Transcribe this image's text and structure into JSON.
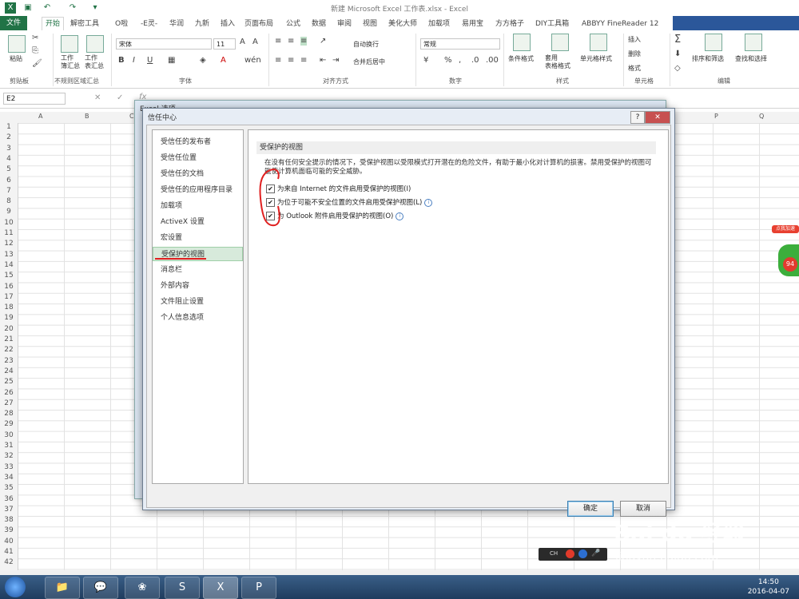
{
  "window": {
    "title": "新建 Microsoft Excel 工作表.xlsx - Excel"
  },
  "tabs": [
    "文件",
    "开始",
    "解密工具",
    "O啦",
    "-E灵-",
    "华润",
    "九新",
    "插入",
    "页面布局",
    "公式",
    "数据",
    "审阅",
    "视图",
    "美化大师",
    "加载项",
    "易用宝",
    "方方格子",
    "DIY工具箱",
    "ABBYY FineReader 12"
  ],
  "ribbon": {
    "paste": "粘贴",
    "summary1": "工作\n簿汇总",
    "summary2": "工作\n表汇总",
    "font_name": "宋体",
    "font_size": "11",
    "wrap": "自动换行",
    "merge": "合并后居中",
    "number_format": "常规",
    "cond_format": "条件格式",
    "table_format": "套用\n表格格式",
    "cell_style": "单元格样式",
    "insert": "插入",
    "delete": "删除",
    "format": "格式",
    "sort": "排序和筛选",
    "find": "查找和选择",
    "groups": [
      "剪贴板",
      "不规则区域汇总",
      "字体",
      "对齐方式",
      "数字",
      "样式",
      "单元格",
      "编辑"
    ]
  },
  "formula_bar": {
    "name_box": "E2"
  },
  "columns": [
    "A",
    "B",
    "C",
    "P",
    "Q"
  ],
  "rows": [
    "1",
    "2",
    "3",
    "4",
    "5",
    "6",
    "7",
    "8",
    "9",
    "10",
    "11",
    "12",
    "13",
    "14",
    "15",
    "16",
    "17",
    "18",
    "19",
    "20",
    "21",
    "22",
    "23",
    "24",
    "25",
    "26",
    "27",
    "28",
    "29",
    "30",
    "31",
    "32",
    "33",
    "34",
    "35",
    "36",
    "37",
    "38",
    "39",
    "40",
    "41",
    "42"
  ],
  "back_dialog": {
    "title": "Excel 选项"
  },
  "dialog": {
    "title": "信任中心",
    "nav": [
      "受信任的发布者",
      "受信任位置",
      "受信任的文档",
      "受信任的应用程序目录",
      "加载项",
      "ActiveX 设置",
      "宏设置",
      "受保护的视图",
      "消息栏",
      "外部内容",
      "文件阻止设置",
      "个人信息选项"
    ],
    "selected_index": 7,
    "section_title": "受保护的视图",
    "description": "在没有任何安全提示的情况下，受保护视图以受限模式打开潜在的危险文件，有助于最小化对计算机的损害。禁用受保护的视图可能使计算机面临可能的安全威胁。",
    "options": [
      {
        "label": "为来自 Internet 的文件启用受保护的视图(I)",
        "checked": true,
        "info": false
      },
      {
        "label": "为位于可能不安全位置的文件启用受保护视图(L)",
        "checked": true,
        "info": true
      },
      {
        "label": "为 Outlook 附件启用受保护的视图(O)",
        "checked": true,
        "info": true
      }
    ],
    "ok": "确定",
    "cancel": "取消"
  },
  "side_widget": {
    "label": "点我加速",
    "value": "94"
  },
  "watermark": {
    "brand": "Bai du 经验",
    "url": "jingyan.baidu.com"
  },
  "taskbar": {
    "time": "14:50",
    "date": "2016-04-07",
    "ime": "CH"
  },
  "colors": {
    "excel_green": "#217346",
    "annotation_red": "#e02020"
  }
}
